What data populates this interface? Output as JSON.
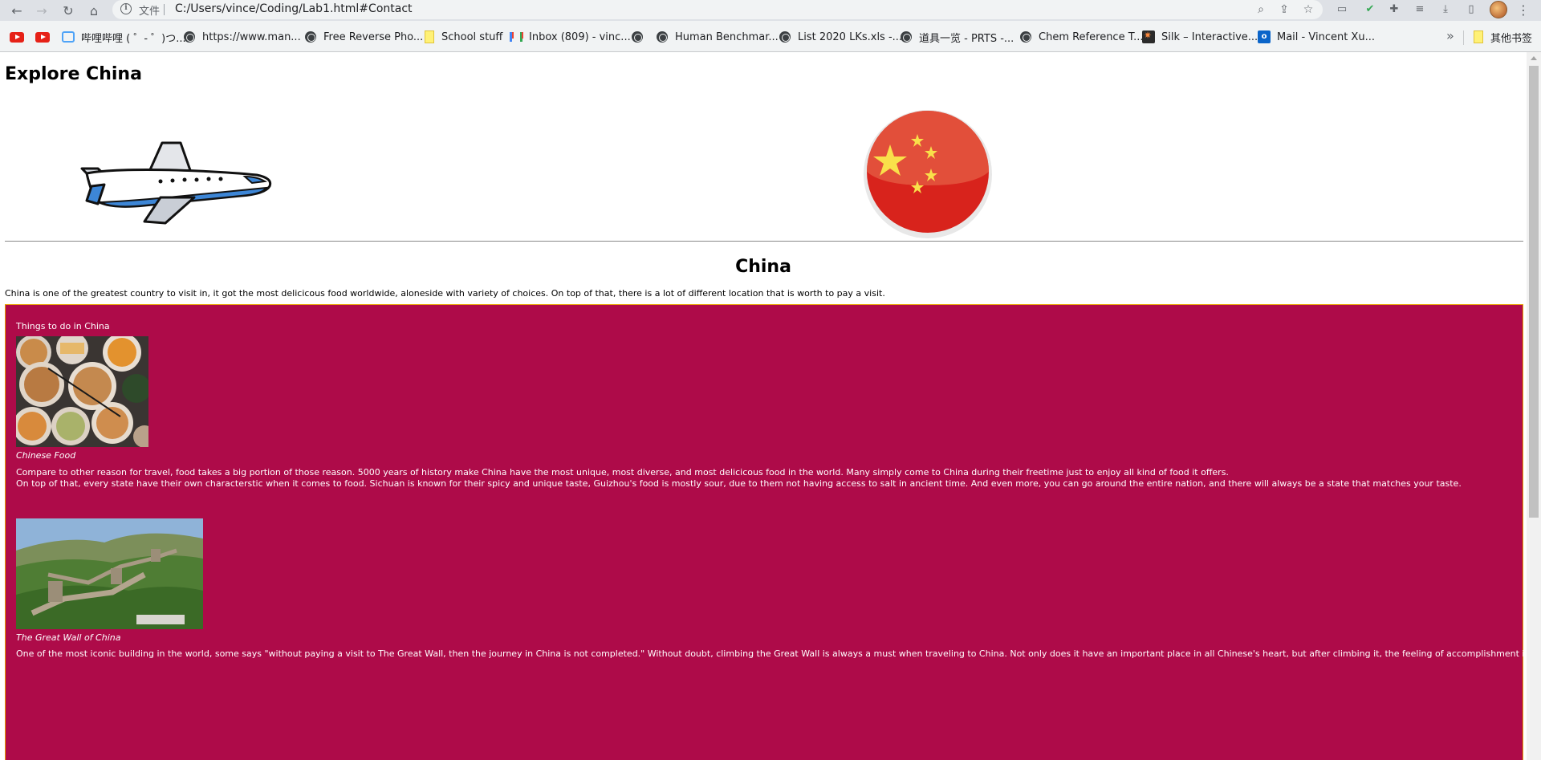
{
  "browser": {
    "address_label": "文件",
    "url": "C:/Users/vince/Coding/Lab1.html#Contact",
    "bookmarks": [
      {
        "label": "",
        "icon": "youtube-icon"
      },
      {
        "label": "",
        "icon": "youtube-icon"
      },
      {
        "label": "哔哩哔哩 ( ゜- ゜)つ...",
        "icon": "bilibili-icon"
      },
      {
        "label": "https://www.man...",
        "icon": "globe-icon"
      },
      {
        "label": "Free Reverse Pho...",
        "icon": "globe-icon"
      },
      {
        "label": "School stuff",
        "icon": "folder-icon"
      },
      {
        "label": "Inbox (809) - vinc...",
        "icon": "gmail-icon"
      },
      {
        "label": "",
        "icon": "globe-icon"
      },
      {
        "label": "Human Benchmar...",
        "icon": "globe-icon"
      },
      {
        "label": "List 2020 LKs.xls -...",
        "icon": "globe-icon"
      },
      {
        "label": "道具一览 - PRTS -...",
        "icon": "globe-icon"
      },
      {
        "label": "Chem Reference T...",
        "icon": "globe-icon"
      },
      {
        "label": "Silk – Interactive...",
        "icon": "silk-icon"
      },
      {
        "label": "Mail - Vincent Xu...",
        "icon": "outlook-icon"
      }
    ],
    "more_chevron": "»",
    "other_bookmarks": "其他书签"
  },
  "page": {
    "site_title": "Explore China",
    "country_heading": "China",
    "intro": "China is one of the greatest country to visit in, it got the most delicicous food worldwide, aloneside with variety of choices. On top of that, there is a lot of different location that is worth to pay a visit.",
    "things": {
      "title": "Things to do in China",
      "background_color": "#ae0b49",
      "items": [
        {
          "caption": "Chinese Food",
          "paragraphs": [
            "Compare to other reason for travel, food takes a big portion of those reason. 5000 years of history make China have the most unique, most diverse, and most delicicous food in the world. Many simply come to China during their freetime just to enjoy all kind of food it offers.",
            "On top of that, every state have their own characterstic when it comes to food. Sichuan is known for their spicy and unique taste, Guizhou's food is mostly sour, due to them not having access to salt in ancient time. And even more, you can go around the entire nation, and there will always be a state that matches your taste."
          ]
        },
        {
          "caption": "The Great Wall of China",
          "paragraphs": [
            "One of the most iconic building in the world, some says \"without paying a visit to The Great Wall, then the journey in China is not completed.\" Without doubt, climbing the Great Wall is always a must when traveling to China. Not only does it have an important place in all Chinese's heart, but after climbing it, the feeling of accomplishment is same for everyone."
          ]
        }
      ]
    }
  }
}
